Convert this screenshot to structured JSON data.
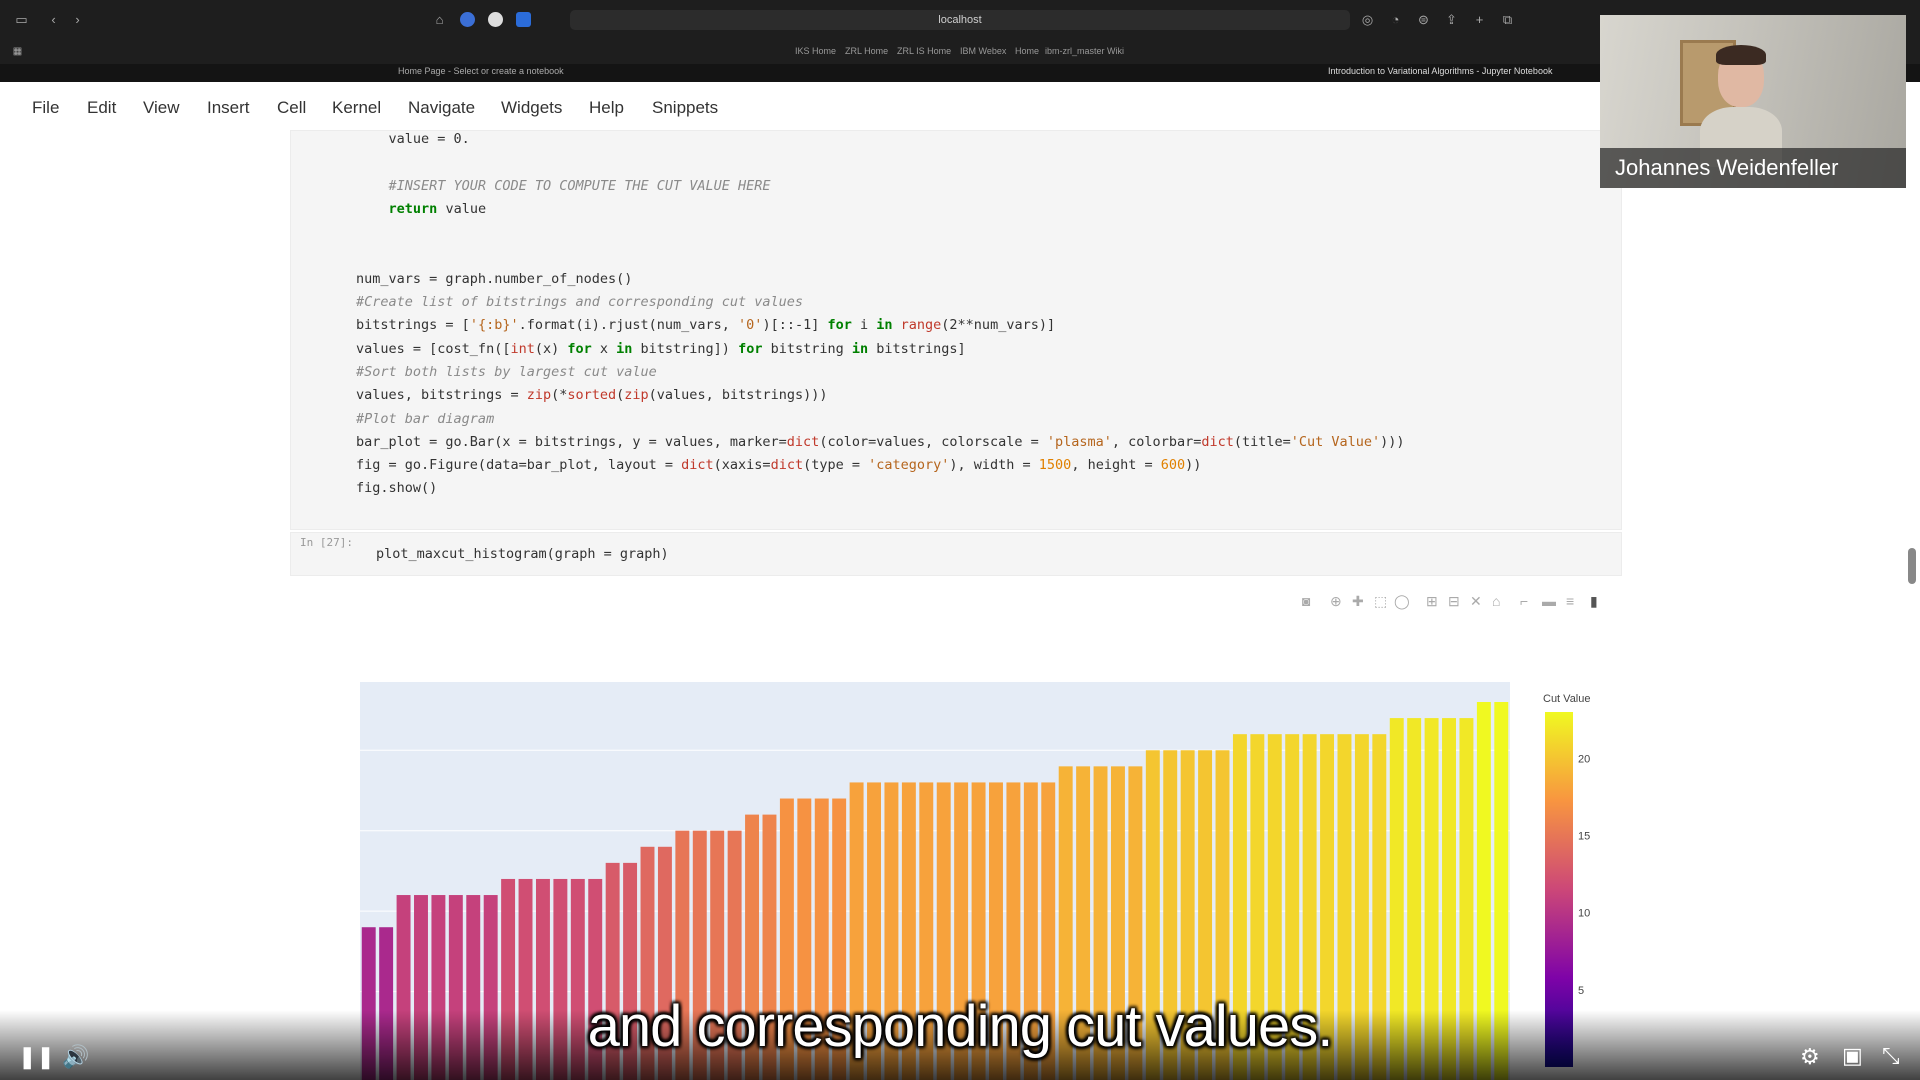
{
  "browser": {
    "address": "localhost",
    "bookmarks": [
      "IKS Home",
      "ZRL Home",
      "ZRL IS Home",
      "IBM Webex",
      "Home",
      "ibm-zrl_master Wiki"
    ],
    "left_tab_title": "Home Page - Select or create a notebook",
    "right_tab_title": "Introduction to Variational Algorithms - Jupyter Notebook"
  },
  "menu": [
    "File",
    "Edit",
    "View",
    "Insert",
    "Cell",
    "Kernel",
    "Navigate",
    "Widgets",
    "Help",
    "Snippets"
  ],
  "code_cell": {
    "lines": [
      "            value = 0.",
      "",
      "            #INSERT YOUR CODE TO COMPUTE THE CUT VALUE HERE",
      "            return value",
      "",
      "",
      "        num_vars = graph.number_of_nodes()",
      "        #Create list of bitstrings and corresponding cut values",
      "        bitstrings = ['{:b}'.format(i).rjust(num_vars, '0')[::-1] for i in range(2**num_vars)]",
      "        values = [cost_fn([int(x) for x in bitstring]) for bitstring in bitstrings]",
      "        #Sort both lists by largest cut value",
      "        values, bitstrings = zip(*sorted(zip(values, bitstrings)))",
      "        #Plot bar diagram",
      "        bar_plot = go.Bar(x = bitstrings, y = values, marker=dict(color=values, colorscale = 'plasma', colorbar=dict(title='Cut Value')))",
      "        fig = go.Figure(data=bar_plot, layout = dict(xaxis=dict(type = 'category'), width = 1500, height = 600))",
      "        fig.show()"
    ]
  },
  "input_cell": {
    "prompt": "In [27]:",
    "code": "plot_maxcut_histogram(graph = graph)"
  },
  "chart_data": {
    "type": "bar",
    "colorscale": "plasma",
    "colorbar": {
      "title": "Cut Value",
      "ticks": [
        "5",
        "10",
        "15",
        "20"
      ],
      "range": [
        0,
        23
      ]
    },
    "ylim": [
      0,
      23
    ],
    "grid": true,
    "values": [
      9,
      9,
      11,
      11,
      11,
      11,
      11,
      11,
      12,
      12,
      12,
      12,
      12,
      12,
      13,
      13,
      14,
      14,
      15,
      15,
      15,
      15,
      16,
      16,
      17,
      17,
      17,
      17,
      18,
      18,
      18,
      18,
      18,
      18,
      18,
      18,
      18,
      18,
      18,
      18,
      19,
      19,
      19,
      19,
      19,
      20,
      20,
      20,
      20,
      20,
      21,
      21,
      21,
      21,
      21,
      21,
      21,
      21,
      21,
      22,
      22,
      22,
      22,
      22,
      23,
      23
    ]
  },
  "video": {
    "presenter_name": "Johannes Weidenfeller",
    "subtitle": "and corresponding cut values."
  }
}
